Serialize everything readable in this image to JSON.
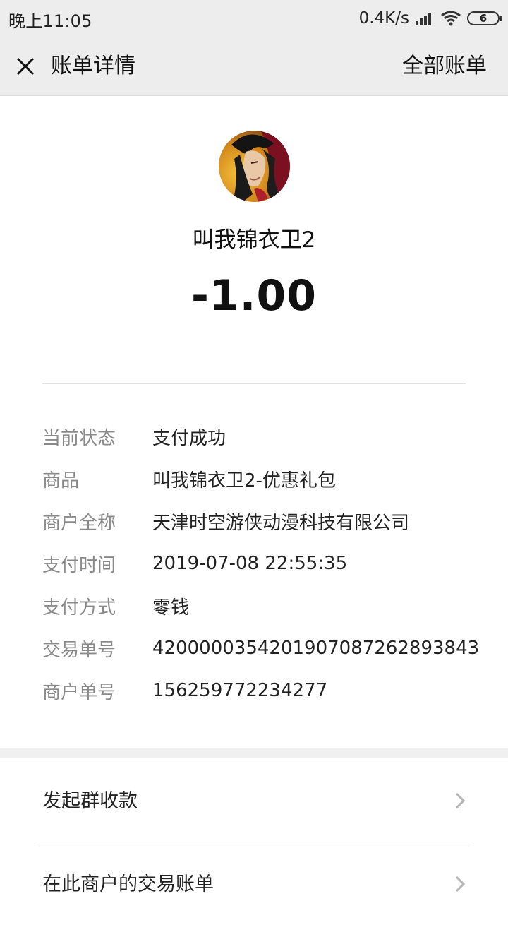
{
  "status_bar": {
    "time": "晚上11:05",
    "net_speed": "0.4K/s",
    "battery_level": "6"
  },
  "nav": {
    "title": "账单详情",
    "right_link": "全部账单"
  },
  "merchant": {
    "name": "叫我锦衣卫2",
    "amount": "-1.00"
  },
  "details": [
    {
      "label": "当前状态",
      "value": "支付成功"
    },
    {
      "label": "商品",
      "value": "叫我锦衣卫2-优惠礼包"
    },
    {
      "label": "商户全称",
      "value": "天津时空游侠动漫科技有限公司"
    },
    {
      "label": "支付时间",
      "value": "2019-07-08 22:55:35"
    },
    {
      "label": "支付方式",
      "value": "零钱"
    },
    {
      "label": "交易单号",
      "value": "4200000354201907087262893843"
    },
    {
      "label": "商户单号",
      "value": "156259772234277"
    }
  ],
  "actions": [
    {
      "label": "发起群收款"
    },
    {
      "label": "在此商户的交易账单"
    }
  ],
  "icons": {
    "close": "close-icon",
    "signal": "signal-icon",
    "wifi": "wifi-icon",
    "battery": "battery-icon",
    "chevron": "chevron-right-icon"
  }
}
